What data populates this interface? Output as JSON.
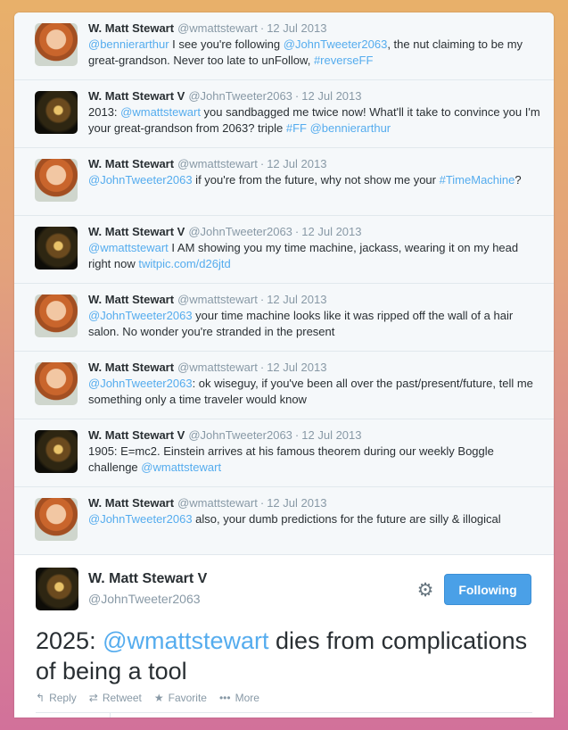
{
  "tweets": [
    {
      "name": "W. Matt Stewart",
      "handle": "@wmattstewart",
      "date": "12 Jul 2013",
      "avatar": "ginger",
      "parts": [
        {
          "t": "@bennierarthur",
          "c": "link"
        },
        {
          "t": " I see you're following "
        },
        {
          "t": "@JohnTweeter2063",
          "c": "link"
        },
        {
          "t": ", the nut claiming to be my great-grandson.  Never too late to unFollow, "
        },
        {
          "t": "#reverseFF",
          "c": "tag"
        }
      ]
    },
    {
      "name": "W. Matt Stewart V",
      "handle": "@JohnTweeter2063",
      "date": "12 Jul 2013",
      "avatar": "dark",
      "parts": [
        {
          "t": "2013: "
        },
        {
          "t": "@wmattstewart",
          "c": "link"
        },
        {
          "t": " you sandbagged me twice now! What'll it take to convince you I'm your great-grandson from 2063? triple "
        },
        {
          "t": "#FF",
          "c": "tag"
        },
        {
          "t": " "
        },
        {
          "t": "@bennierarthur",
          "c": "link"
        }
      ]
    },
    {
      "name": "W. Matt Stewart",
      "handle": "@wmattstewart",
      "date": "12 Jul 2013",
      "avatar": "ginger",
      "parts": [
        {
          "t": "@JohnTweeter2063",
          "c": "link"
        },
        {
          "t": " if you're from the future, why not show me your "
        },
        {
          "t": "#TimeMachine",
          "c": "tag"
        },
        {
          "t": "?"
        }
      ]
    },
    {
      "name": "W. Matt Stewart V",
      "handle": "@JohnTweeter2063",
      "date": "12 Jul 2013",
      "avatar": "dark",
      "parts": [
        {
          "t": "@wmattstewart",
          "c": "link"
        },
        {
          "t": " I AM showing you my time machine, jackass, wearing it on my head right now "
        },
        {
          "t": "twitpic.com/d26jtd",
          "c": "link"
        }
      ]
    },
    {
      "name": "W. Matt Stewart",
      "handle": "@wmattstewart",
      "date": "12 Jul 2013",
      "avatar": "ginger",
      "parts": [
        {
          "t": "@JohnTweeter2063",
          "c": "link"
        },
        {
          "t": " your time machine looks like it was ripped off the wall of a hair salon. No wonder you're stranded in the present"
        }
      ]
    },
    {
      "name": "W. Matt Stewart",
      "handle": "@wmattstewart",
      "date": "12 Jul 2013",
      "avatar": "ginger",
      "parts": [
        {
          "t": "@JohnTweeter2063",
          "c": "link"
        },
        {
          "t": ": ok wiseguy, if you've been all over the past/present/future, tell me something only a time traveler would know"
        }
      ]
    },
    {
      "name": "W. Matt Stewart V",
      "handle": "@JohnTweeter2063",
      "date": "12 Jul 2013",
      "avatar": "dark",
      "parts": [
        {
          "t": "1905: E=mc2. Einstein arrives at his famous theorem during our weekly Boggle challenge "
        },
        {
          "t": "@wmattstewart",
          "c": "link"
        }
      ]
    },
    {
      "name": "W. Matt Stewart",
      "handle": "@wmattstewart",
      "date": "12 Jul 2013",
      "avatar": "ginger",
      "parts": [
        {
          "t": "@JohnTweeter2063",
          "c": "link"
        },
        {
          "t": " also, your dumb predictions for the future are silly & illogical"
        }
      ]
    }
  ],
  "main": {
    "name": "W. Matt Stewart V",
    "handle": "@JohnTweeter2063",
    "follow_label": "Following",
    "gear_icon": "gear-icon",
    "text_prefix": "2025: ",
    "text_link": "@wmattstewart",
    "text_suffix": " dies from complications of being a tool",
    "actions": [
      {
        "icon": "reply-icon",
        "glyph": "↰",
        "label": "Reply"
      },
      {
        "icon": "retweet-icon",
        "glyph": "⇄",
        "label": "Retweet"
      },
      {
        "icon": "star-icon",
        "glyph": "★",
        "label": "Favorite"
      },
      {
        "icon": "more-icon",
        "glyph": "•••",
        "label": "More"
      }
    ]
  },
  "colors": {
    "link": "#55acee",
    "follow_button": "#4aa0e7"
  }
}
